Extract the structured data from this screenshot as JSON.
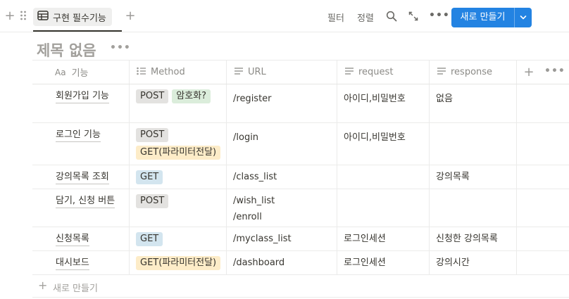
{
  "toolbar": {
    "view_tab_label": "구현 필수기능",
    "filter_label": "필터",
    "sort_label": "정렬",
    "new_button_label": "새로 만들기"
  },
  "page": {
    "title": "제목 없음"
  },
  "columns": {
    "name": "기능",
    "name_type": "Aa",
    "method": "Method",
    "url": "URL",
    "request": "request",
    "response": "response"
  },
  "rows": [
    {
      "name": "회원가입 기능",
      "tags": [
        {
          "label": "POST",
          "color": "#e3e2e0"
        },
        {
          "label": "암호화?",
          "color": "#dbeddb"
        }
      ],
      "url": [
        "/register"
      ],
      "request": "아이디,비밀번호",
      "response": "없음"
    },
    {
      "name": "로그인 기능",
      "tags": [
        {
          "label": "POST",
          "color": "#e3e2e0"
        },
        {
          "label": "GET(파라미터전달)",
          "color": "#fdecc8"
        }
      ],
      "url": [
        "/login"
      ],
      "request": "아이디,비밀번호",
      "response": ""
    },
    {
      "name": "강의목록 조회",
      "tags": [
        {
          "label": "GET",
          "color": "#d3e5ef"
        }
      ],
      "url": [
        "/class_list"
      ],
      "request": "",
      "response": "강의목록"
    },
    {
      "name": "담기, 신청 버튼",
      "tags": [
        {
          "label": "POST",
          "color": "#e3e2e0"
        }
      ],
      "url": [
        "/wish_list",
        "/enroll"
      ],
      "request": "",
      "response": ""
    },
    {
      "name": "신청목록",
      "tags": [
        {
          "label": "GET",
          "color": "#d3e5ef"
        }
      ],
      "url": [
        "/myclass_list"
      ],
      "request": "로그인세션",
      "response": "신청한 강의목록"
    },
    {
      "name": "대시보드",
      "tags": [
        {
          "label": "GET(파라미터전달)",
          "color": "#fdecc8"
        }
      ],
      "url": [
        "/dashboard"
      ],
      "request": "로그인세션",
      "response": "강의시간"
    }
  ],
  "new_row_label": "새로 만들기",
  "colors": {
    "accent": "#2383e2"
  }
}
